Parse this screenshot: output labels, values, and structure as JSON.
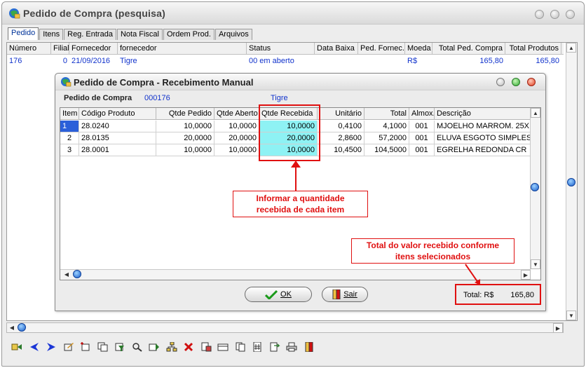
{
  "main": {
    "title": "Pedido de Compra  (pesquisa)",
    "tabs": [
      "Pedido",
      "Itens",
      "Reg. Entrada",
      "Nota Fiscal",
      "Ordem Prod.",
      "Arquivos"
    ],
    "columns": [
      "Número",
      "Filial",
      "Fornecedor",
      "fornecedor",
      "Status",
      "Data Baixa",
      "Ped. Fornec.",
      "Moeda",
      "Total Ped. Compra",
      "Total Produtos"
    ],
    "row": {
      "numero": "176",
      "filial": "0",
      "data": "21/09/2016",
      "fornecedor": "Tigre",
      "status": "00 em aberto",
      "data_baixa": "",
      "ped_fornec": "",
      "moeda": "R$",
      "total_ped": "165,80",
      "total_prod": "165,80"
    }
  },
  "dialog": {
    "title": "Pedido de Compra - Recebimento Manual",
    "pedido_label": "Pedido de Compra",
    "pedido_num": "000176",
    "fornecedor": "Tigre",
    "columns": [
      "Item",
      "Código Produto",
      "Qtde Pedido",
      "Qtde Aberto",
      "Qtde Recebida",
      "Unitário",
      "Total",
      "Almox.",
      "Descrição"
    ],
    "rows": [
      {
        "item": "1",
        "codigo": "28.0240",
        "qtde_pedido": "10,0000",
        "qtde_aberto": "10,0000",
        "qtde_recebida": "10,0000",
        "unitario": "0,4100",
        "total": "4,1000",
        "almox": "001",
        "descricao": "MJOELHO MARROM. 25X"
      },
      {
        "item": "2",
        "codigo": "28.0135",
        "qtde_pedido": "20,0000",
        "qtde_aberto": "20,0000",
        "qtde_recebida": "20,0000",
        "unitario": "2,8600",
        "total": "57,2000",
        "almox": "001",
        "descricao": "ELUVA ESGOTO SIMPLES"
      },
      {
        "item": "3",
        "codigo": "28.0001",
        "qtde_pedido": "10,0000",
        "qtde_aberto": "10,0000",
        "qtde_recebida": "10,0000",
        "unitario": "10,4500",
        "total": "104,5000",
        "almox": "001",
        "descricao": "EGRELHA  REDONDA CR"
      }
    ],
    "ok_label": "OK",
    "sair_label": "Sair",
    "total_label": "Total: R$",
    "total_value": "165,80"
  },
  "annotations": {
    "col_note": "Informar a quantidade recebida de cada item",
    "col_note_line1": "Informar a quantidade",
    "col_note_line2": "recebida de cada item",
    "total_note_line1": "Total do valor recebido conforme",
    "total_note_line2": "itens selecionados",
    "color": "#e01010"
  },
  "toolbar": {
    "icons": [
      "exit-icon",
      "previous-icon",
      "next-icon",
      "edit-icon",
      "insert-icon",
      "copy-icon",
      "filter-icon",
      "search-icon",
      "select-icon",
      "tree-icon",
      "delete-icon",
      "print-preview-icon",
      "card-icon",
      "documents-icon",
      "calculator-icon",
      "import-icon",
      "printer-icon",
      "close-door-icon"
    ]
  }
}
